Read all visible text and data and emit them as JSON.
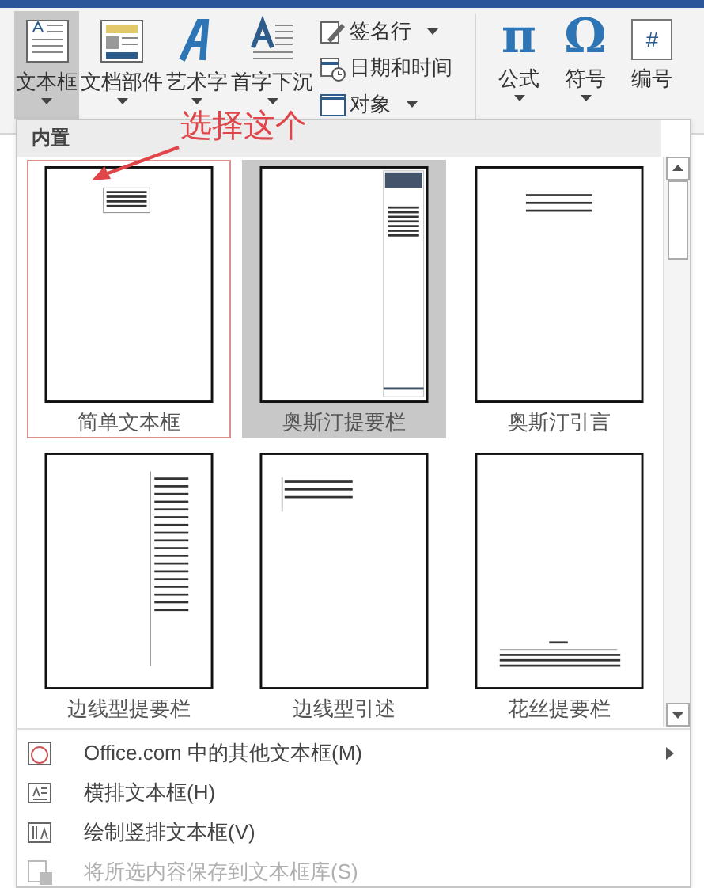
{
  "ribbon": {
    "large_buttons": [
      {
        "label": "文本框",
        "kind": "textbox",
        "selected": true,
        "dropdown": true
      },
      {
        "label": "文档部件",
        "kind": "parts",
        "selected": false,
        "dropdown": true
      },
      {
        "label": "艺术字",
        "kind": "wordart",
        "selected": false,
        "dropdown": true
      },
      {
        "label": "首字下沉",
        "kind": "dropcap",
        "selected": false,
        "dropdown": true
      }
    ],
    "small_buttons": [
      {
        "label": "签名行",
        "kind": "signature",
        "dropdown": true
      },
      {
        "label": "日期和时间",
        "kind": "datetime",
        "dropdown": false
      },
      {
        "label": "对象",
        "kind": "object",
        "dropdown": true
      }
    ],
    "symbol_buttons": [
      {
        "label": "公式",
        "kind": "pi",
        "glyph": "π",
        "dropdown": true
      },
      {
        "label": "符号",
        "kind": "omega",
        "glyph": "Ω",
        "dropdown": true
      },
      {
        "label": "编号",
        "kind": "number",
        "glyph": "#",
        "dropdown": false
      }
    ]
  },
  "gallery": {
    "header": "内置",
    "items": [
      {
        "label": "简单文本框",
        "kind": "simple",
        "selected": false,
        "marked": true
      },
      {
        "label": "奥斯汀提要栏",
        "kind": "sidebar",
        "selected": true,
        "marked": false
      },
      {
        "label": "奥斯汀引言",
        "kind": "quote",
        "selected": false,
        "marked": false
      },
      {
        "label": "边线型提要栏",
        "kind": "lined",
        "selected": false,
        "marked": false
      },
      {
        "label": "边线型引述",
        "kind": "topquote",
        "selected": false,
        "marked": false
      },
      {
        "label": "花丝提要栏",
        "kind": "bottom",
        "selected": false,
        "marked": false
      }
    ]
  },
  "annotation": {
    "text": "选择这个"
  },
  "menu": [
    {
      "label": "Office.com 中的其他文本框(M)",
      "kind": "online",
      "disabled": false,
      "submenu": true
    },
    {
      "label": "横排文本框(H)",
      "kind": "horizontal",
      "disabled": false,
      "submenu": false
    },
    {
      "label": "绘制竖排文本框(V)",
      "kind": "vertical",
      "disabled": false,
      "submenu": false
    },
    {
      "label": "将所选内容保存到文本框库(S)",
      "kind": "save",
      "disabled": true,
      "submenu": false
    }
  ]
}
